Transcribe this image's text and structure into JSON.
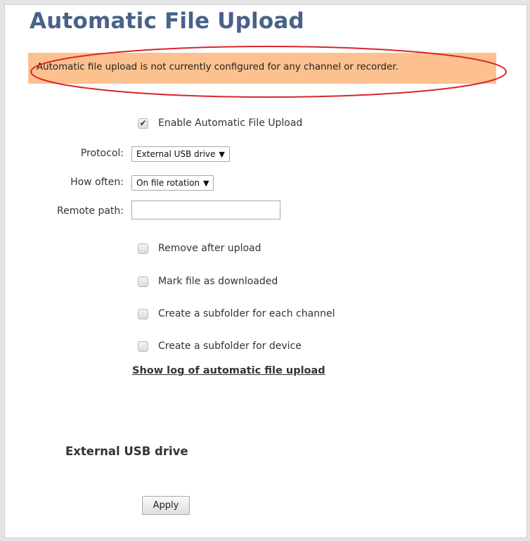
{
  "page": {
    "title": "Automatic File Upload"
  },
  "alert": {
    "message": "Automatic file upload is not currently configured for any channel or recorder.",
    "background_color": "#fcc18f",
    "highlight_color": "#d9262b"
  },
  "form": {
    "enable": {
      "label": "Enable Automatic File Upload",
      "checked": true
    },
    "protocol": {
      "label": "Protocol:",
      "value": "External USB drive"
    },
    "how_often": {
      "label": "How often:",
      "value": "On file rotation"
    },
    "remote_path": {
      "label": "Remote path:",
      "value": ""
    },
    "remove_after_upload": {
      "label": "Remove after upload",
      "checked": false
    },
    "mark_downloaded": {
      "label": "Mark file as downloaded",
      "checked": false
    },
    "subfolder_channel": {
      "label": "Create a subfolder for each channel",
      "checked": false
    },
    "subfolder_device": {
      "label": "Create a subfolder for device",
      "checked": false
    },
    "log_link": "Show log of automatic file upload"
  },
  "section": {
    "title": "External USB drive"
  },
  "actions": {
    "apply_label": "Apply"
  },
  "icons": {
    "checked": "checkmark-icon",
    "dropdown": "triangle-down-icon"
  },
  "colors": {
    "title": "#4a6189",
    "background": "#e4e4e4"
  }
}
